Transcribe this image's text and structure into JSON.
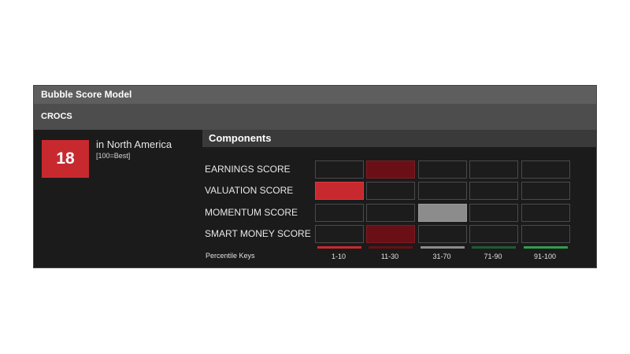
{
  "widget": {
    "title": "Bubble Score Model",
    "ticker": "CROCS"
  },
  "score": {
    "value": "18",
    "region": "in North America",
    "scale_note": "[100=Best]"
  },
  "components": {
    "header": "Components",
    "rows": [
      {
        "label": "EARNINGS SCORE",
        "bucket": "11-30"
      },
      {
        "label": "VALUATION SCORE",
        "bucket": "1-10"
      },
      {
        "label": "MOMENTUM SCORE",
        "bucket": "31-70"
      },
      {
        "label": "SMART MONEY SCORE",
        "bucket": "11-30"
      }
    ],
    "keys_label": "Percentile Keys",
    "keys": [
      {
        "label": "1-10",
        "color": "#c8292f"
      },
      {
        "label": "11-30",
        "color": "#6a0f15"
      },
      {
        "label": "31-70",
        "color": "#8c8c8c"
      },
      {
        "label": "71-90",
        "color": "#1f5a33"
      },
      {
        "label": "91-100",
        "color": "#2f9e4b"
      }
    ]
  }
}
